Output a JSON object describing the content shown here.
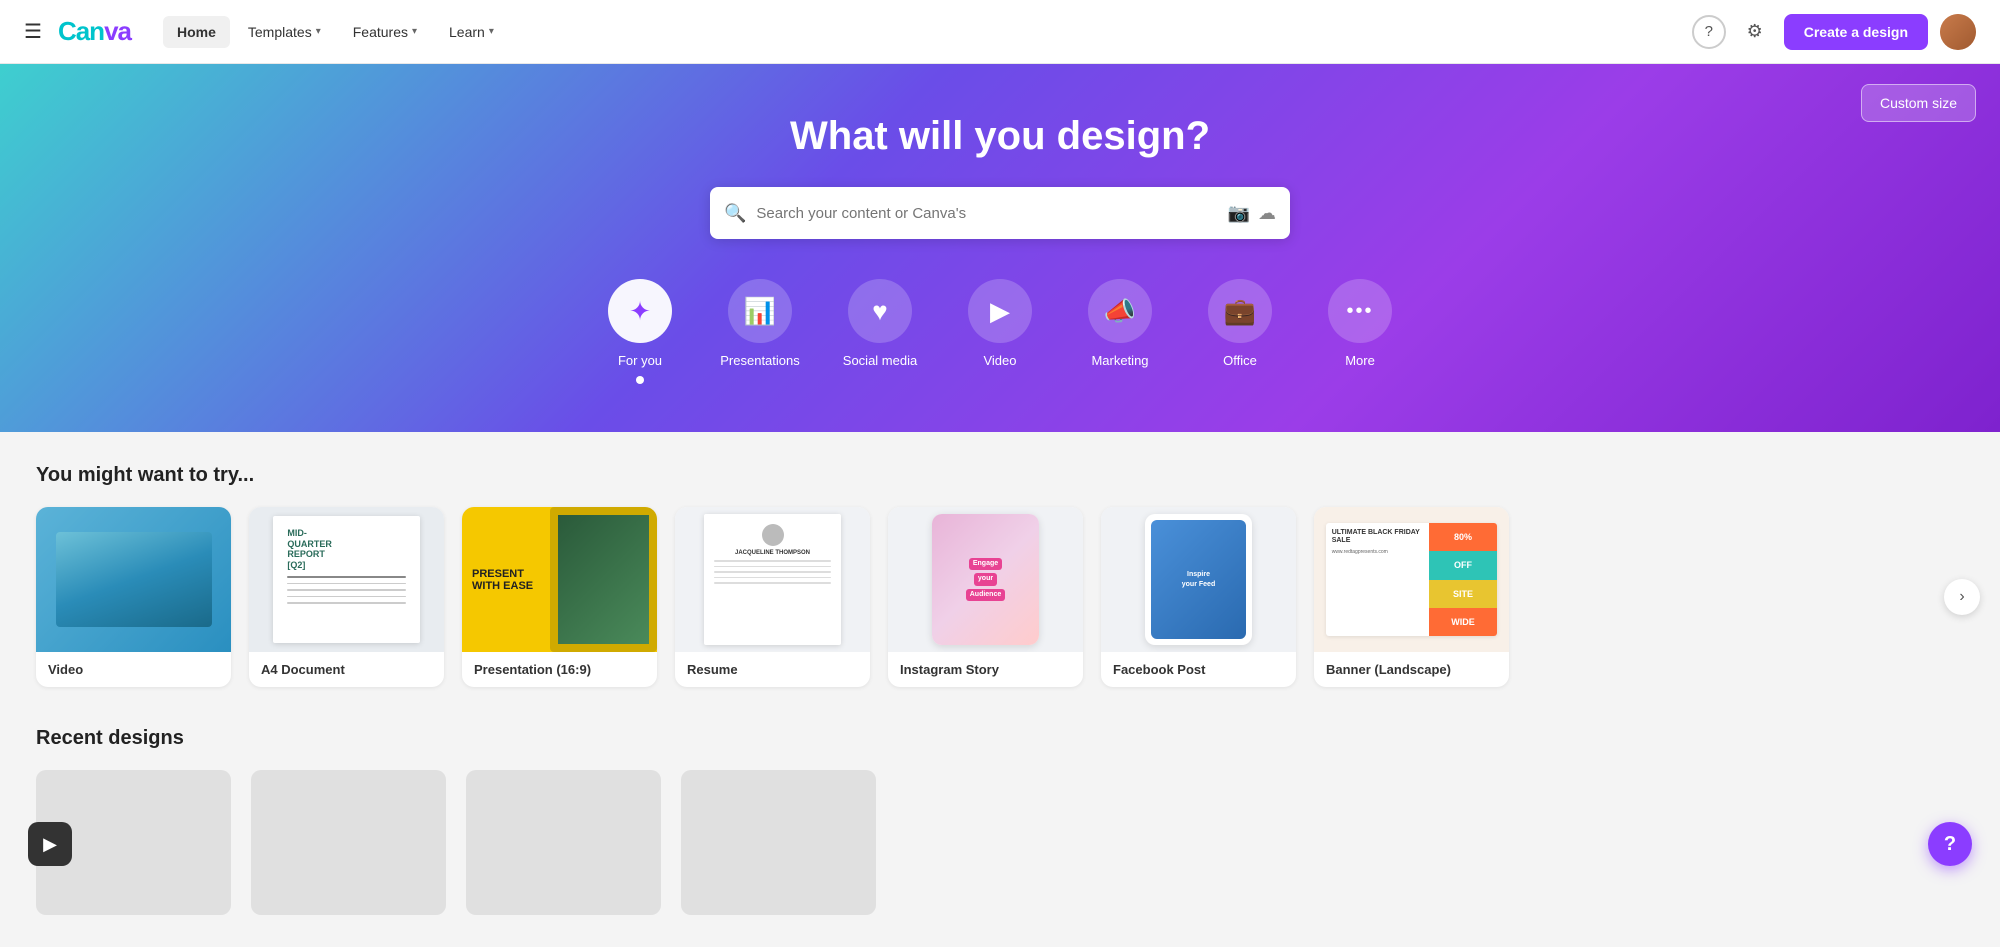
{
  "nav": {
    "logo": "Canva",
    "home_label": "Home",
    "templates_label": "Templates",
    "features_label": "Features",
    "learn_label": "Learn",
    "help_tooltip": "Help",
    "settings_tooltip": "Settings",
    "create_btn": "Create a design"
  },
  "hero": {
    "title": "What will you design?",
    "search_placeholder": "Search your content or Canva's",
    "custom_size_btn": "Custom size",
    "categories": [
      {
        "id": "for-you",
        "label": "For you",
        "active": true
      },
      {
        "id": "presentations",
        "label": "Presentations",
        "active": false
      },
      {
        "id": "social-media",
        "label": "Social media",
        "active": false
      },
      {
        "id": "video",
        "label": "Video",
        "active": false
      },
      {
        "id": "marketing",
        "label": "Marketing",
        "active": false
      },
      {
        "id": "office",
        "label": "Office",
        "active": false
      },
      {
        "id": "more",
        "label": "More",
        "active": false
      }
    ]
  },
  "try_section": {
    "title": "You might want to try...",
    "cards": [
      {
        "label": "Video",
        "type": "video"
      },
      {
        "label": "A4 Document",
        "type": "a4"
      },
      {
        "label": "Presentation (16:9)",
        "type": "presentation"
      },
      {
        "label": "Resume",
        "type": "resume"
      },
      {
        "label": "Instagram Story",
        "type": "instagram"
      },
      {
        "label": "Facebook Post",
        "type": "facebook"
      },
      {
        "label": "Banner (Landscape)",
        "type": "banner"
      }
    ]
  },
  "recent_section": {
    "title": "Recent designs"
  },
  "a4_thumb": {
    "line1": "MID-",
    "line2": "QUARTER",
    "line3": "REPORT",
    "line4": "[Q2]"
  },
  "pres_thumb": {
    "text1": "PRESENT",
    "text2": "WITH EASE"
  },
  "resume_thumb": {
    "name": "JACQUELINE THOMPSON"
  },
  "ig_thumb": {
    "badge1": "Engage",
    "badge2": "your",
    "badge3": "Audience"
  },
  "fb_thumb": {
    "text1": "Inspire",
    "text2": "your Feed"
  },
  "banner_thumb": {
    "title": "ULTIMATE BLACK FRIDAY SALE",
    "sub": "www.redtagpresents.com",
    "block1": "80%",
    "block2": "OFF",
    "block3": "SITE",
    "block4": "WIDE"
  }
}
